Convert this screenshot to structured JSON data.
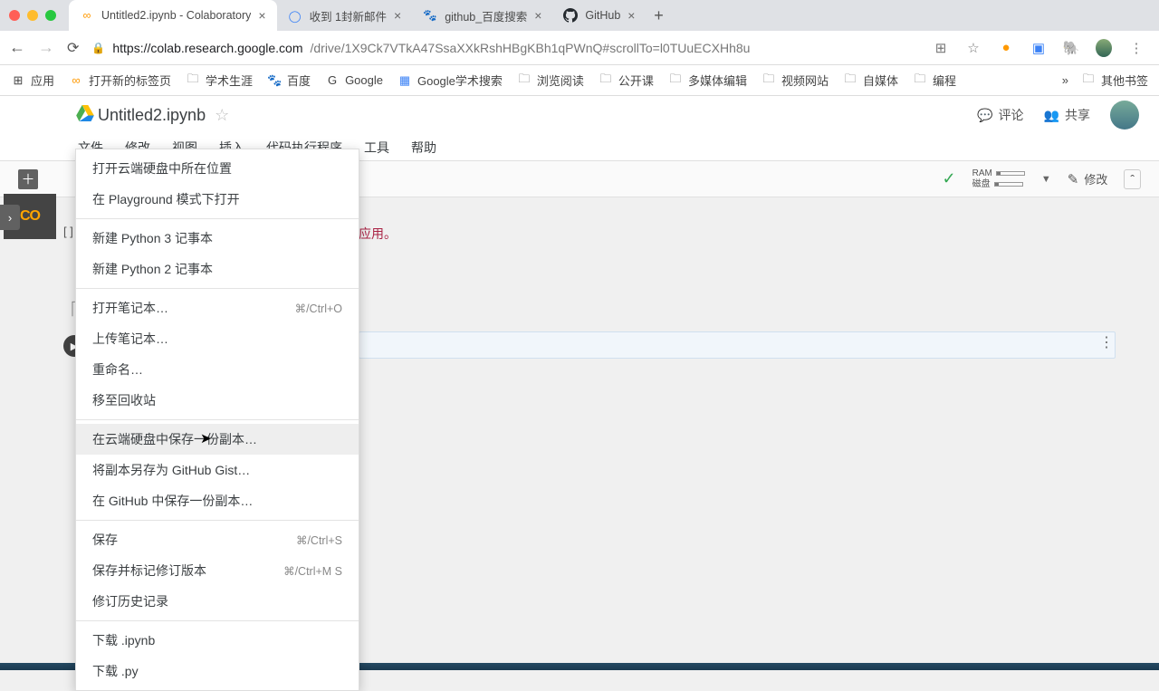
{
  "browser": {
    "tabs": [
      {
        "title": "Untitled2.ipynb - Colaboratory",
        "active": true
      },
      {
        "title": "收到 1封新邮件",
        "active": false
      },
      {
        "title": "github_百度搜索",
        "active": false
      },
      {
        "title": "GitHub",
        "active": false
      }
    ],
    "url_host": "https://colab.research.google.com",
    "url_path": "/drive/1X9Ck7VTkA47SsaXXkRshHBgKBh1qPWnQ#scrollTo=l0TUuECXHh8u",
    "new_tab": "+"
  },
  "bookmarks": {
    "apps": "应用",
    "items": [
      "打开新的标签页",
      "学术生涯",
      "百度",
      "Google",
      "Google学术搜索",
      "浏览阅读",
      "公开课",
      "多媒体编辑",
      "视频网站",
      "自媒体",
      "编程"
    ],
    "more": "»",
    "other": "其他书签"
  },
  "colab": {
    "notebook_title": "Untitled2.ipynb",
    "menus": [
      "文件",
      "修改",
      "视图",
      "插入",
      "代码执行程序",
      "工具",
      "帮助"
    ],
    "comment": "评论",
    "share": "共享",
    "ram_label": "RAM",
    "disk_label": "磁盘",
    "edit_label": "修改",
    "cell_index": "[ ]",
    "note_text": "应用。"
  },
  "file_menu": {
    "items": [
      {
        "label": "打开云端硬盘中所在位置"
      },
      {
        "label": "在 Playground 模式下打开"
      },
      {
        "sep": true
      },
      {
        "label": "新建 Python 3 记事本"
      },
      {
        "label": "新建 Python 2 记事本"
      },
      {
        "sep": true
      },
      {
        "label": "打开笔记本…",
        "shortcut": "⌘/Ctrl+O"
      },
      {
        "label": "上传笔记本…"
      },
      {
        "label": "重命名…"
      },
      {
        "label": "移至回收站"
      },
      {
        "sep": true
      },
      {
        "label": "在云端硬盘中保存一份副本…",
        "hover": true
      },
      {
        "label": "将副本另存为 GitHub Gist…"
      },
      {
        "label": "在 GitHub 中保存一份副本…"
      },
      {
        "sep": true
      },
      {
        "label": "保存",
        "shortcut": "⌘/Ctrl+S"
      },
      {
        "label": "保存并标记修订版本",
        "shortcut": "⌘/Ctrl+M S"
      },
      {
        "label": "修订历史记录"
      },
      {
        "sep": true
      },
      {
        "label": "下载 .ipynb"
      },
      {
        "label": "下载 .py"
      }
    ]
  }
}
